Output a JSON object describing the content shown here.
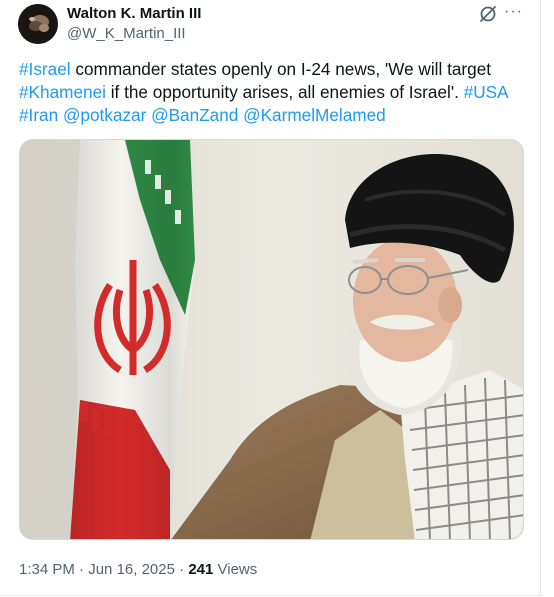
{
  "author": {
    "display_name": "Walton K. Martin III",
    "handle": "@W_K_Martin_III"
  },
  "icons": {
    "grok": "grok-slash-icon",
    "more": "more-horizontal-icon",
    "more_glyph": "···"
  },
  "tweet": {
    "segments": [
      {
        "text": "#Israel",
        "kind": "hashtag"
      },
      {
        "text": " commander states openly on I-24 news, 'We will target ",
        "kind": "text"
      },
      {
        "text": "#Khamenei",
        "kind": "hashtag"
      },
      {
        "text": " if the opportunity arises, all enemies of Israel'. ",
        "kind": "text"
      },
      {
        "text": "#USA",
        "kind": "hashtag"
      },
      {
        "text": " ",
        "kind": "text"
      },
      {
        "text": "#Iran",
        "kind": "hashtag"
      },
      {
        "text": " ",
        "kind": "text"
      },
      {
        "text": "@potkazar",
        "kind": "mention"
      },
      {
        "text": " ",
        "kind": "text"
      },
      {
        "text": "@BanZand",
        "kind": "mention"
      },
      {
        "text": " ",
        "kind": "text"
      },
      {
        "text": "@KarmelMelamed",
        "kind": "mention"
      }
    ]
  },
  "meta": {
    "time": "1:34 PM",
    "separator": " · ",
    "date": "Jun 16, 2025",
    "views_count": "241",
    "views_label": " Views"
  },
  "colors": {
    "link": "#1d9bf0",
    "secondary_text": "#536471",
    "primary_text": "#0f1419"
  }
}
